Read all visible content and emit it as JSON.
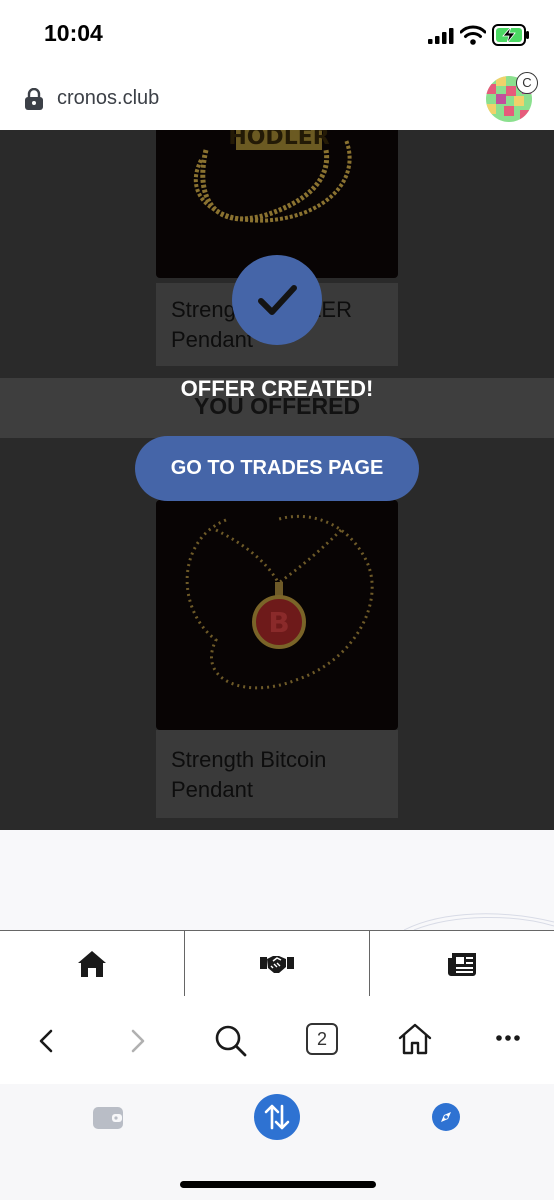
{
  "status_bar": {
    "time": "10:04"
  },
  "url_bar": {
    "url": "cronos.club",
    "avatar_badge": "C"
  },
  "page": {
    "cards": [
      {
        "name_line1": "Strength HODLER",
        "name_line2": "Pendant",
        "image_text": "HODLER"
      },
      {
        "name_line1": "Strength Bitcoin",
        "name_line2": "Pendant",
        "image_symbol": "B"
      }
    ],
    "section_title": "YOU OFFERED"
  },
  "modal": {
    "message": "OFFER CREATED!",
    "button_label": "GO TO TRADES PAGE",
    "accent_color": "#4565a8"
  },
  "app_nav": {
    "items": [
      "home-icon",
      "handshake-icon",
      "newspaper-icon"
    ]
  },
  "browser_toolbar": {
    "tabs_count": "2"
  },
  "bottom_bar": {
    "items": [
      "wallet-icon",
      "swap-icon",
      "compass-icon"
    ],
    "accent_color": "#2e72d2"
  }
}
